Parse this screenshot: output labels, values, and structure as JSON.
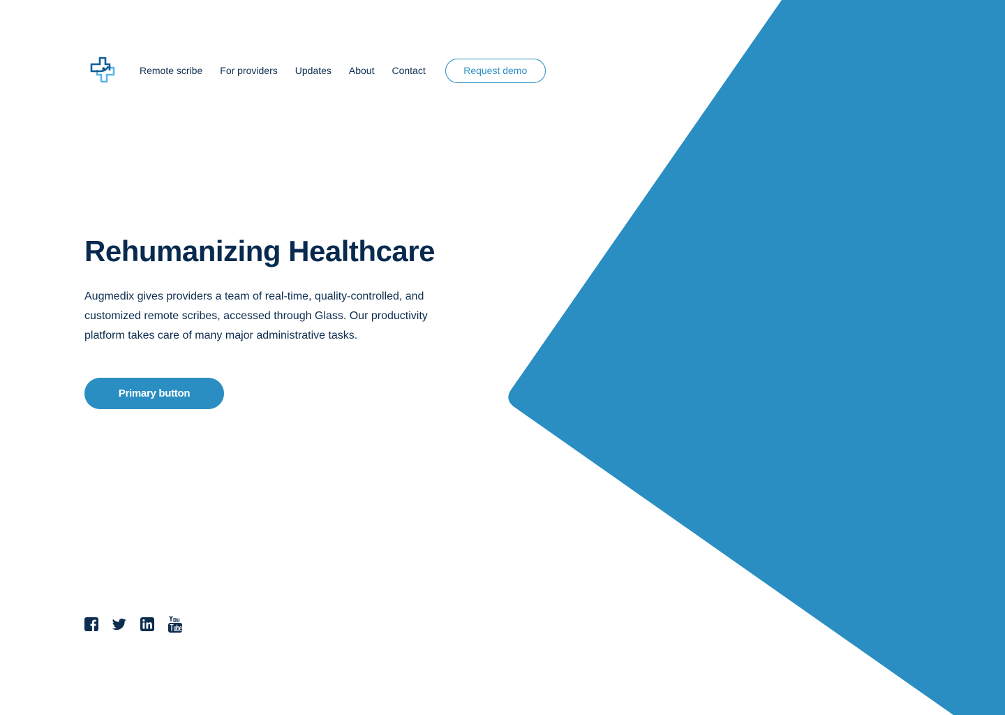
{
  "nav": {
    "links": [
      {
        "label": "Remote scribe"
      },
      {
        "label": "For providers"
      },
      {
        "label": "Updates"
      },
      {
        "label": "About"
      },
      {
        "label": "Contact"
      }
    ],
    "cta_label": "Request demo",
    "logo_icon": "medical-cross-logo-icon"
  },
  "hero": {
    "title": "Rehumanizing Healthcare",
    "description": "Augmedix gives providers a team of real-time, quality-controlled, and customized remote scribes, accessed through Glass. Our productivity platform takes care of many major administrative tasks.",
    "primary_button_label": "Primary button"
  },
  "social": {
    "icons": [
      "facebook-icon",
      "twitter-icon",
      "linkedin-icon",
      "youtube-icon"
    ]
  },
  "colors": {
    "brand_blue": "#2a8ec3",
    "navy_text": "#0d2d4f",
    "logo_light_blue": "#5bb5e8",
    "background": "#ffffff"
  }
}
